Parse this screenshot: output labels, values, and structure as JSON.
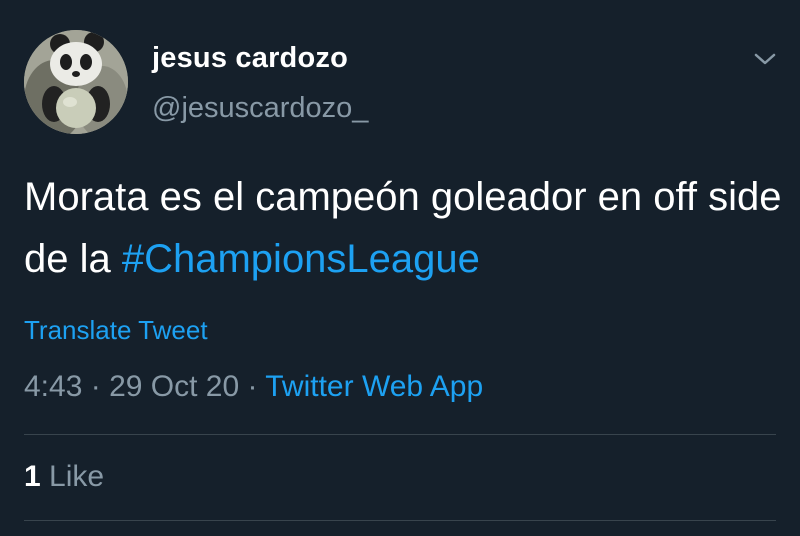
{
  "author": {
    "display_name": "jesus cardozo",
    "handle": "@jesuscardozo_",
    "avatar_icon": "panda-avatar"
  },
  "tweet": {
    "text_plain": "Morata es el campeón goleador en off side de la ",
    "hashtag": "#ChampionsLeague",
    "translate_label": "Translate Tweet"
  },
  "meta": {
    "time": "4:43",
    "separator1": " · ",
    "date": "29 Oct 20",
    "separator2": " · ",
    "source": "Twitter Web App"
  },
  "stats": {
    "likes_count": "1",
    "likes_label": "Like"
  },
  "icons": {
    "menu": "chevron-down-icon"
  },
  "colors": {
    "background": "#15202b",
    "accent": "#1da1f2",
    "secondary_text": "#8899a6",
    "divider": "#38444d"
  }
}
